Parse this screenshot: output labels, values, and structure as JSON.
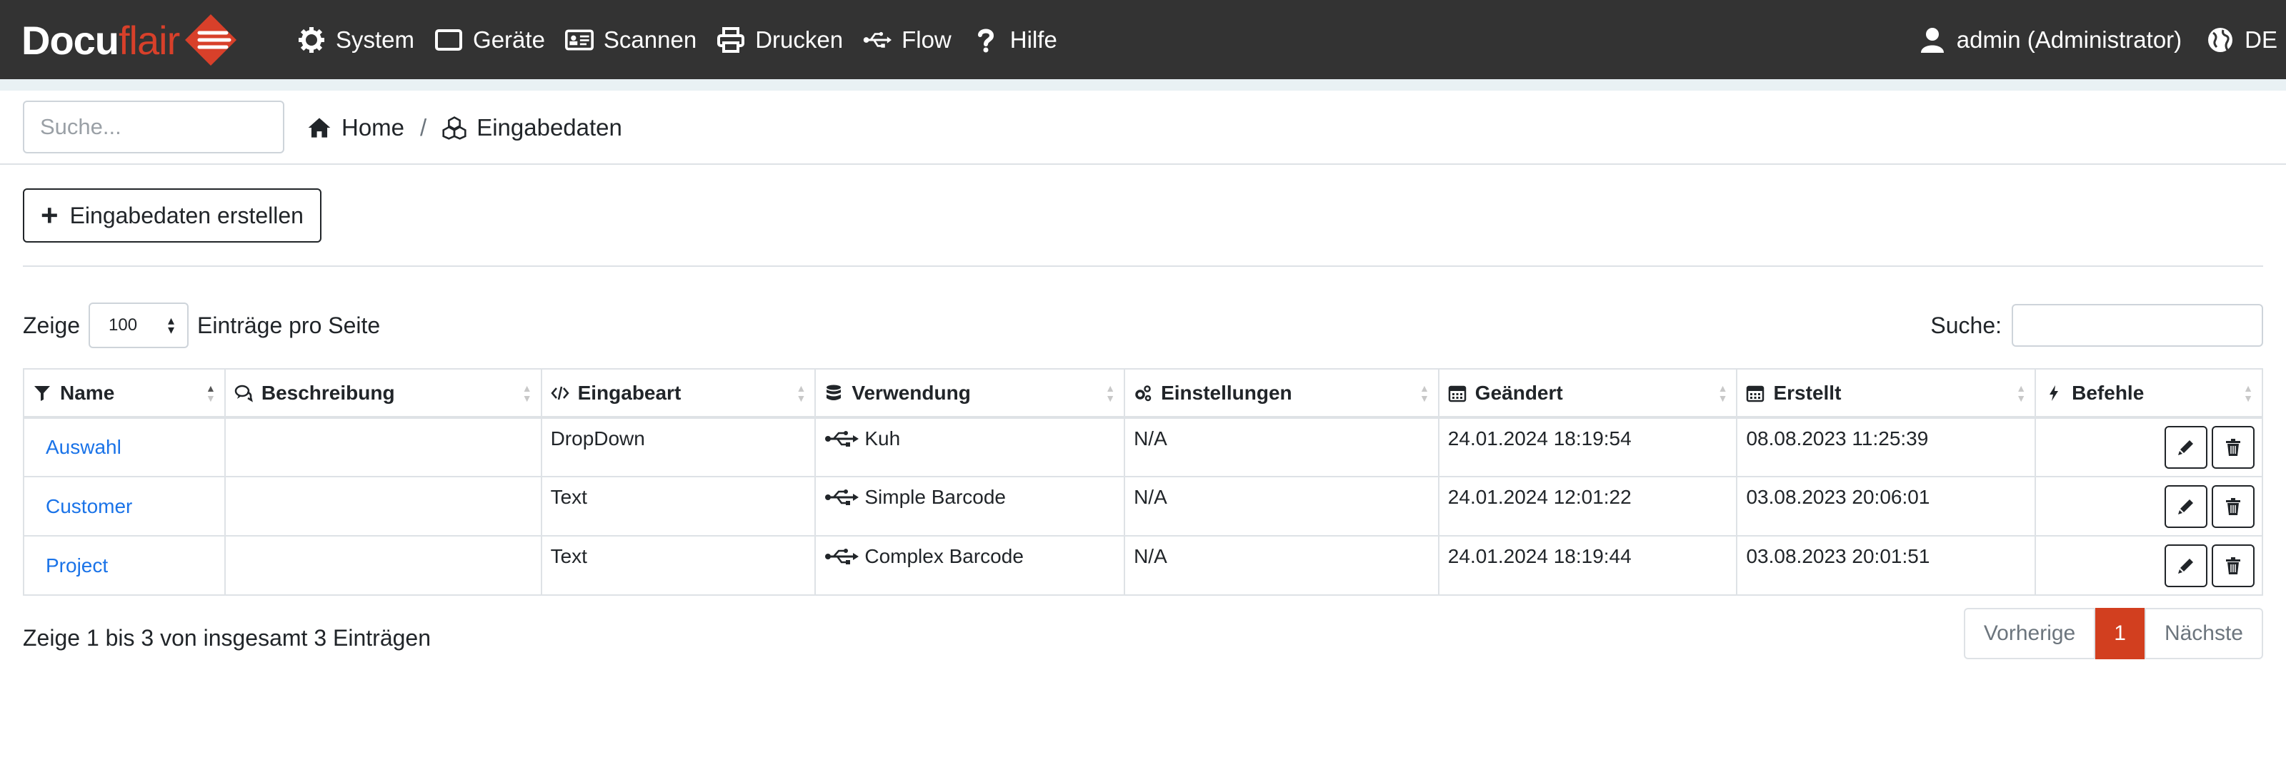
{
  "brand": {
    "part1": "Docu",
    "part2": "flair"
  },
  "nav": {
    "items": [
      {
        "label": "System",
        "icon": "gear-icon"
      },
      {
        "label": "Geräte",
        "icon": "tablet-icon"
      },
      {
        "label": "Scannen",
        "icon": "id-card-icon"
      },
      {
        "label": "Drucken",
        "icon": "printer-icon"
      },
      {
        "label": "Flow",
        "icon": "usb-icon"
      },
      {
        "label": "Hilfe",
        "icon": "question-icon"
      }
    ],
    "user": "admin (Administrator)",
    "language": "DE"
  },
  "search": {
    "placeholder": "Suche..."
  },
  "breadcrumb": {
    "home": "Home",
    "current": "Eingabedaten"
  },
  "create_button": "Eingabedaten erstellen",
  "length": {
    "prefix": "Zeige",
    "value": "100",
    "suffix": "Einträge pro Seite"
  },
  "filter": {
    "label": "Suche:"
  },
  "table": {
    "columns": [
      {
        "label": "Name",
        "icon": "filter-icon"
      },
      {
        "label": "Beschreibung",
        "icon": "comments-icon"
      },
      {
        "label": "Eingabeart",
        "icon": "code-icon"
      },
      {
        "label": "Verwendung",
        "icon": "database-icon"
      },
      {
        "label": "Einstellungen",
        "icon": "cogs-icon"
      },
      {
        "label": "Geändert",
        "icon": "calendar-icon"
      },
      {
        "label": "Erstellt",
        "icon": "calendar-icon"
      },
      {
        "label": "Befehle",
        "icon": "bolt-icon"
      }
    ],
    "rows": [
      {
        "name": "Auswahl",
        "description": "",
        "type": "DropDown",
        "usage": "Kuh",
        "settings": "N/A",
        "changed": "24.01.2024 18:19:54",
        "created": "08.08.2023 11:25:39"
      },
      {
        "name": "Customer",
        "description": "",
        "type": "Text",
        "usage": "Simple Barcode",
        "settings": "N/A",
        "changed": "24.01.2024 12:01:22",
        "created": "03.08.2023 20:06:01"
      },
      {
        "name": "Project",
        "description": "",
        "type": "Text",
        "usage": "Complex Barcode",
        "settings": "N/A",
        "changed": "24.01.2024 18:19:44",
        "created": "03.08.2023 20:01:51"
      }
    ]
  },
  "info": "Zeige 1 bis 3 von insgesamt 3 Einträgen",
  "pagination": {
    "prev": "Vorherige",
    "current": "1",
    "next": "Nächste"
  },
  "colors": {
    "navbar": "#333333",
    "accent": "#d23f1f",
    "link": "#1a73e8"
  }
}
